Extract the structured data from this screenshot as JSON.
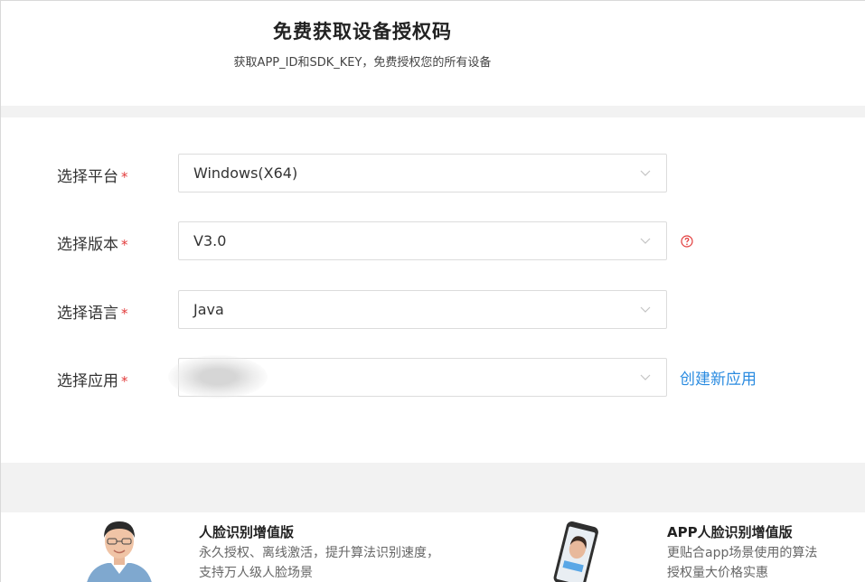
{
  "header": {
    "title": "免费获取设备授权码",
    "subtitle": "获取APP_ID和SDK_KEY，免费授权您的所有设备"
  },
  "form": {
    "platform": {
      "label": "选择平台",
      "required_mark": "*",
      "value": "Windows(X64)"
    },
    "version": {
      "label": "选择版本",
      "required_mark": "*",
      "value": "V3.0",
      "help_icon": "question-circle-icon"
    },
    "language": {
      "label": "选择语言",
      "required_mark": "*",
      "value": "Java"
    },
    "app": {
      "label": "选择应用",
      "required_mark": "*",
      "value": "",
      "create_link": "创建新应用"
    }
  },
  "promos": [
    {
      "title": "人脸识别增值版",
      "line1": "永久授权、离线激活，提升算法识别速度，",
      "line2": "支持万人级人脸场景",
      "image": "person-avatar"
    },
    {
      "title": "APP人脸识别增值版",
      "line1": "更贴合app场景使用的算法",
      "line2": "授权量大价格实惠",
      "image": "phone-face-icon"
    }
  ],
  "colors": {
    "required": "#e23b3b",
    "link": "#2a8be0",
    "band": "#f2f2f2",
    "border": "#dcdcdc"
  }
}
